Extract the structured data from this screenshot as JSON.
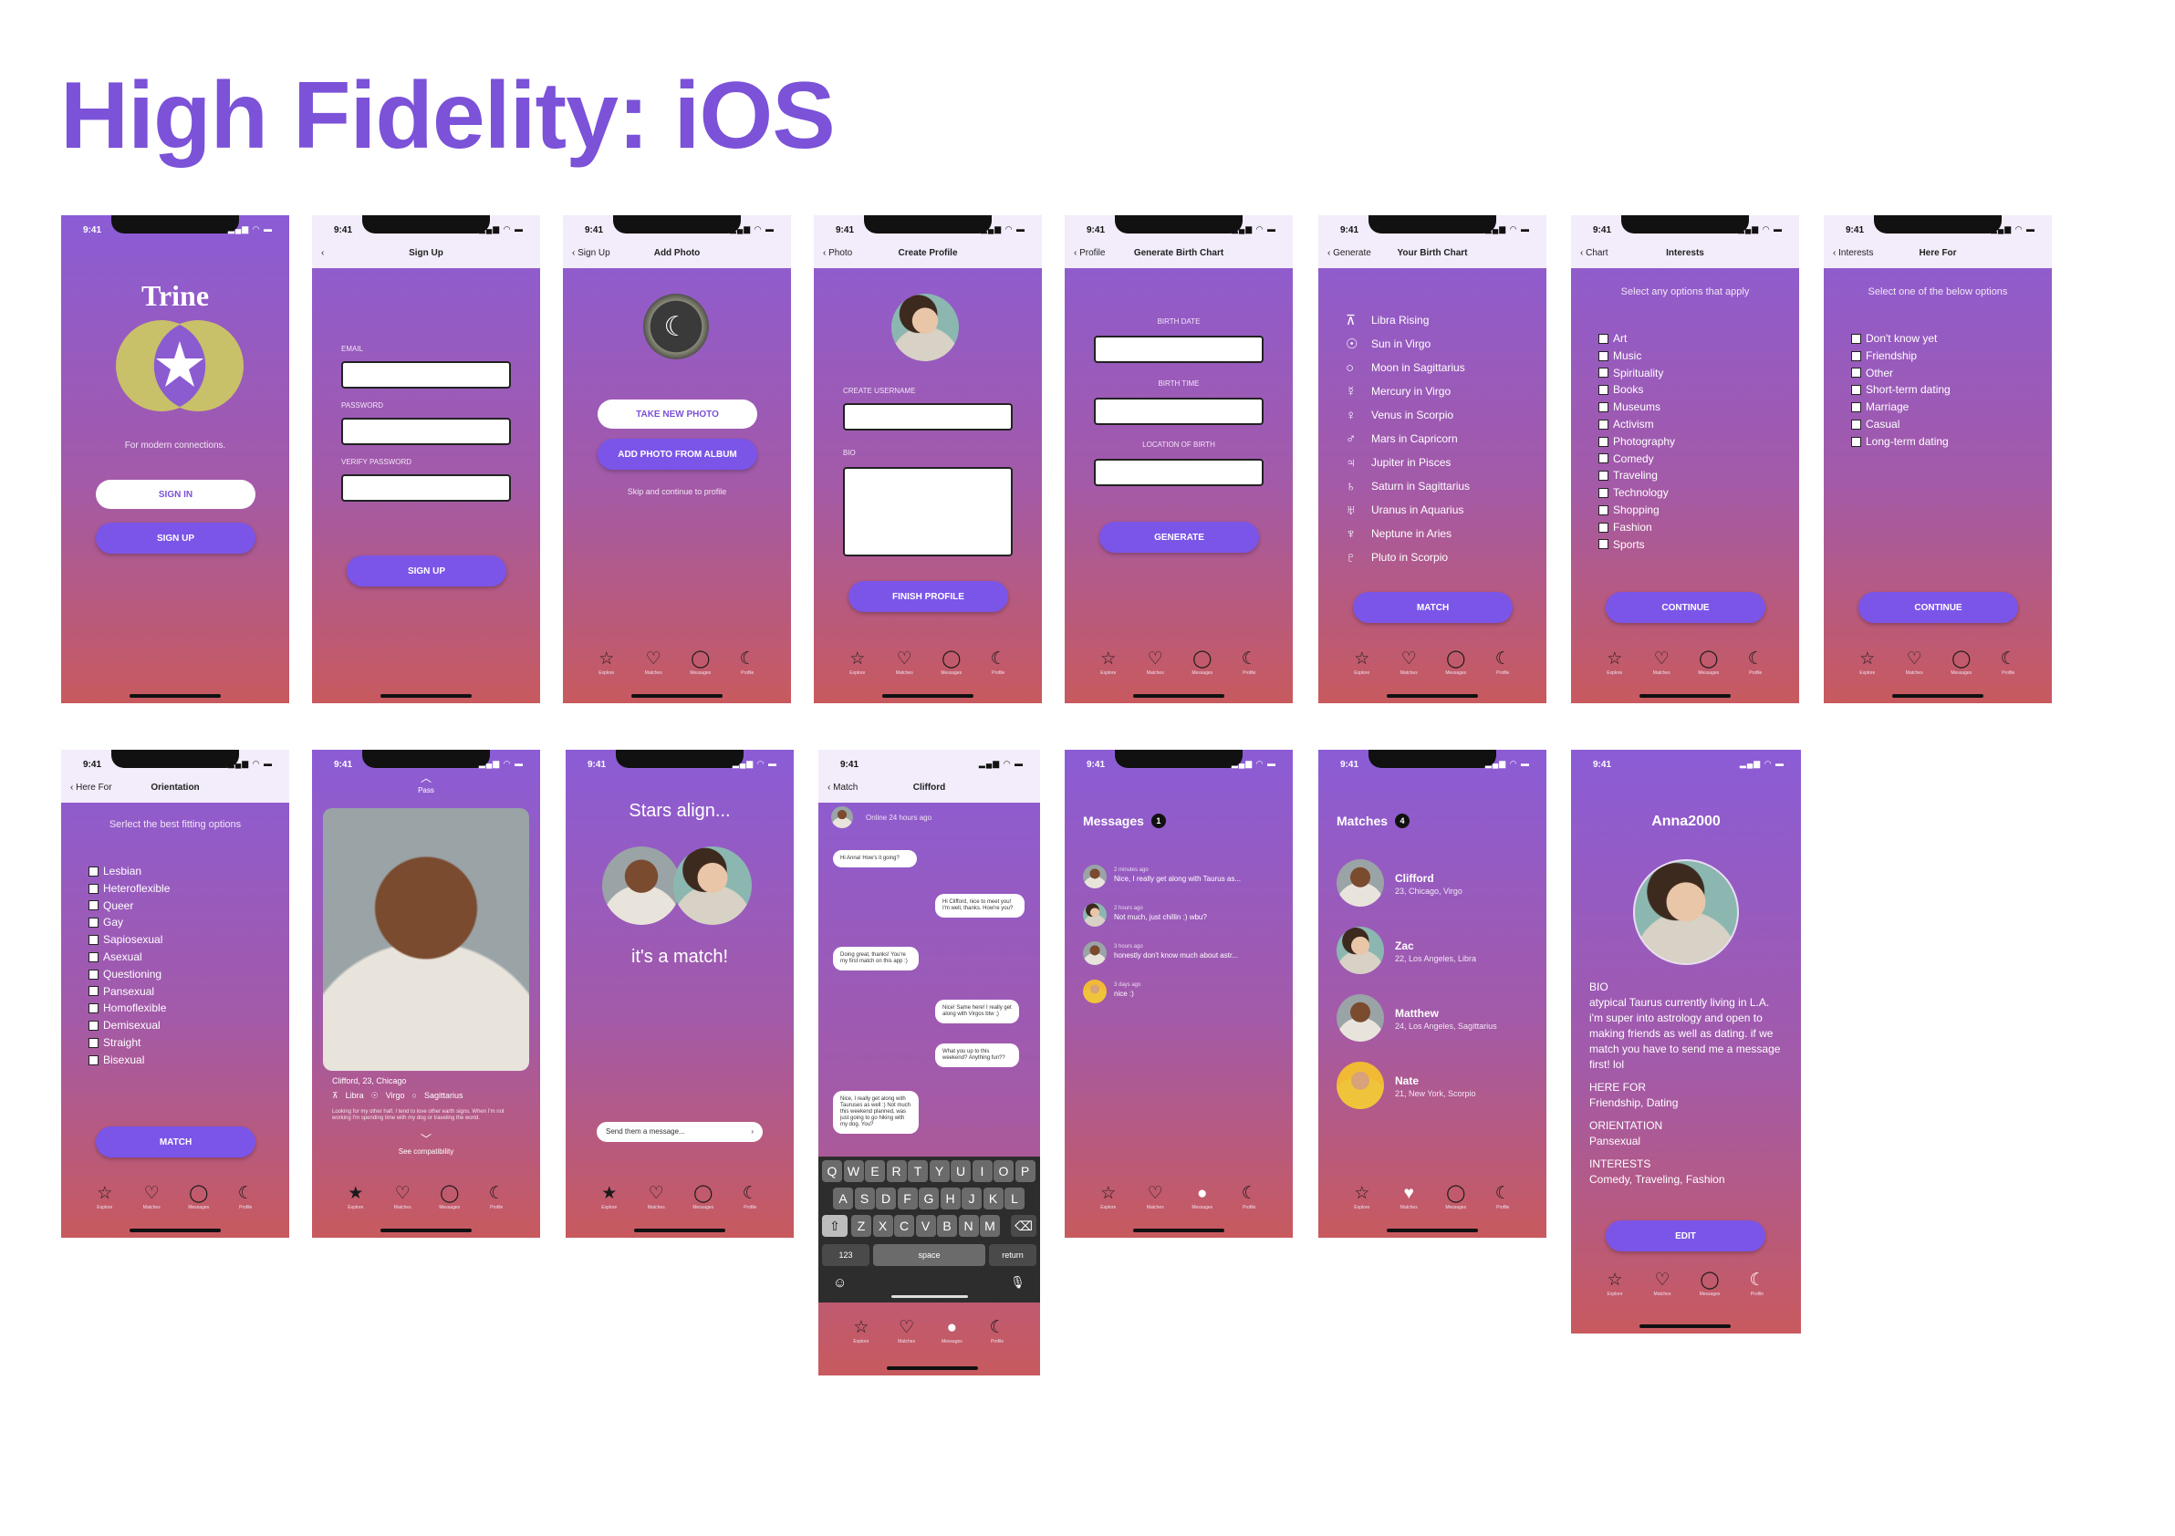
{
  "page_title": "High Fidelity: iOS",
  "status": {
    "time": "9:41",
    "icons": "▂▄▆ ◠ ▬"
  },
  "tabs": [
    {
      "icon": "star-icon",
      "glyph": "☆",
      "label": "Explore"
    },
    {
      "icon": "heart-icon",
      "glyph": "♡",
      "label": "Matches"
    },
    {
      "icon": "chat-bubble-icon",
      "glyph": "◯",
      "label": "Messages"
    },
    {
      "icon": "moon-icon",
      "glyph": "☾",
      "label": "Profile"
    }
  ],
  "s1": {
    "logo": "Trine",
    "tagline": "For modern connections.",
    "signin": "SIGN IN",
    "signup": "SIGN UP"
  },
  "s2": {
    "title": "Sign Up",
    "email": "EMAIL",
    "password": "PASSWORD",
    "verify": "VERIFY PASSWORD",
    "signup": "SIGN UP"
  },
  "s3": {
    "back": "Sign Up",
    "title": "Add Photo",
    "take": "TAKE NEW PHOTO",
    "album": "ADD PHOTO FROM ALBUM",
    "skip": "Skip and continue to profile"
  },
  "s4": {
    "back": "Photo",
    "title": "Create Profile",
    "username": "CREATE USERNAME",
    "bio": "BIO",
    "finish": "FINISH PROFILE"
  },
  "s5": {
    "back": "Profile",
    "title": "Generate Birth Chart",
    "date": "BIRTH DATE",
    "time": "BIRTH TIME",
    "loc": "LOCATION OF BIRTH",
    "generate": "GENERATE"
  },
  "s6": {
    "back": "Generate",
    "title": "Your Birth Chart",
    "match": "MATCH",
    "items": [
      {
        "g": "⊼",
        "t": "Libra Rising"
      },
      {
        "g": "☉",
        "t": "Sun in Virgo"
      },
      {
        "g": "○",
        "t": "Moon in Sagittarius"
      },
      {
        "g": "☿",
        "t": "Mercury in Virgo"
      },
      {
        "g": "♀",
        "t": "Venus in Scorpio"
      },
      {
        "g": "♂",
        "t": "Mars in Capricorn"
      },
      {
        "g": "♃",
        "t": "Jupiter in Pisces"
      },
      {
        "g": "♄",
        "t": "Saturn in Sagittarius"
      },
      {
        "g": "♅",
        "t": "Uranus in Aquarius"
      },
      {
        "g": "♆",
        "t": "Neptune in Aries"
      },
      {
        "g": "♇",
        "t": "Pluto in Scorpio"
      }
    ]
  },
  "s7": {
    "back": "Chart",
    "title": "Interests",
    "sub": "Select any options that apply",
    "cont": "CONTINUE",
    "items": [
      "Art",
      "Music",
      "Spirituality",
      "Books",
      "Museums",
      "Activism",
      "Photography",
      "Comedy",
      "Traveling",
      "Technology",
      "Shopping",
      "Fashion",
      "Sports"
    ]
  },
  "s8": {
    "back": "Interests",
    "title": "Here For",
    "sub": "Select one of the below options",
    "cont": "CONTINUE",
    "items": [
      "Don't know yet",
      "Friendship",
      "Other",
      "Short-term dating",
      "Marriage",
      "Casual",
      "Long-term dating"
    ]
  },
  "s9": {
    "back": "Here For",
    "title": "Orientation",
    "sub": "Serlect the best fitting options",
    "match": "MATCH",
    "items": [
      "Lesbian",
      "Heteroflexible",
      "Queer",
      "Gay",
      "Sapiosexual",
      "Asexual",
      "Questioning",
      "Pansexual",
      "Homoflexible",
      "Demisexual",
      "Straight",
      "Bisexual"
    ]
  },
  "s10": {
    "pass": "Pass",
    "name": "Clifford, 23, Chicago",
    "signs": [
      "Libra",
      "Virgo",
      "Sagittarius"
    ],
    "bio": "Looking for my other half. I tend to love other earth signs. When I'm not working I'm spending time with my dog or traveling the world.",
    "see": "See compatibility"
  },
  "s11": {
    "title": "Stars align...",
    "match": "it's a match!",
    "placeholder": "Send them a message..."
  },
  "s12": {
    "back": "Match",
    "title": "Clifford",
    "online": "Online 24 hours ago",
    "msgs": [
      "Hi Anna! How's it going?",
      "Hi Clifford, nice to meet you! I'm well, thanks. How're you?",
      "Doing great, thanks! You're my first match on this app :)",
      "Nice! Same here! I really get along with Virgos btw ;)",
      "What you up to this weekend? Anything fun??",
      "Nice, I really get along with Tauruses as well :) Not much this weekend planned, was just going to go hiking with my dog. You?"
    ],
    "keys1": [
      "Q",
      "W",
      "E",
      "R",
      "T",
      "Y",
      "U",
      "I",
      "O",
      "P"
    ],
    "keys2": [
      "A",
      "S",
      "D",
      "F",
      "G",
      "H",
      "J",
      "K",
      "L"
    ],
    "keys3": [
      "Z",
      "X",
      "C",
      "V",
      "B",
      "N",
      "M"
    ],
    "num": "123",
    "space": "space",
    "ret": "return"
  },
  "s13": {
    "title": "Messages",
    "badge": "1",
    "items": [
      {
        "time": "2 minutes ago",
        "text": "Nice, I really get along with Taurus as..."
      },
      {
        "time": "2 hours ago",
        "text": "Not much, just chillin :) wbu?"
      },
      {
        "time": "3 hours ago",
        "text": "honestly don't know much about astr..."
      },
      {
        "time": "3 days ago",
        "text": "nice :)"
      }
    ]
  },
  "s14": {
    "title": "Matches",
    "badge": "4",
    "items": [
      {
        "name": "Clifford",
        "info": "23, Chicago, Virgo"
      },
      {
        "name": "Zac",
        "info": "22, Los Angeles, Libra"
      },
      {
        "name": "Matthew",
        "info": "24, Los Angeles, Sagittarius"
      },
      {
        "name": "Nate",
        "info": "21, New York, Scorpio"
      }
    ]
  },
  "s15": {
    "title": "Anna2000",
    "bio_h": "BIO",
    "bio": "atypical Taurus currently living in L.A. i'm super into astrology and open to making friends as well as dating. if we match you have to send me a message first! lol",
    "here_h": "HERE FOR",
    "here": "Friendship, Dating",
    "or_h": "ORIENTATION",
    "or": "Pansexual",
    "int_h": "INTERESTS",
    "int": "Comedy, Traveling, Fashion",
    "edit": "EDIT"
  }
}
